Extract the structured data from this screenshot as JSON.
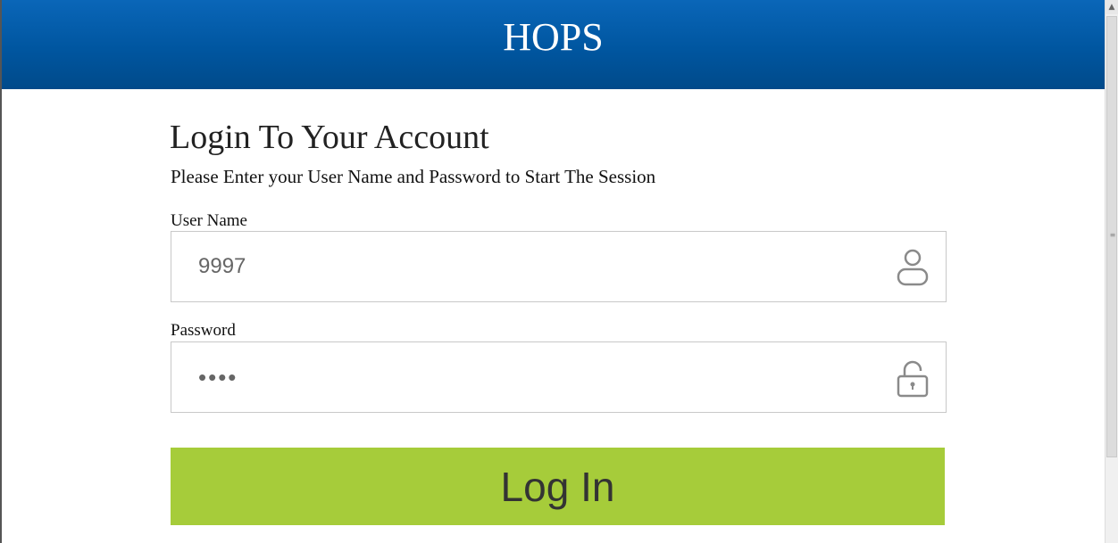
{
  "header": {
    "app_title": "HOPS",
    "bg_color": "#0056a0"
  },
  "login": {
    "title": "Login To Your Account",
    "subtitle": "Please Enter your User Name and Password to Start The Session",
    "username": {
      "label": "User Name",
      "value": "9997",
      "icon": "user-icon"
    },
    "password": {
      "label": "Password",
      "masked_value": "••••",
      "icon": "unlock-icon"
    },
    "button_label": "Log In",
    "button_color": "#a6cc3a"
  },
  "scrollbar": {
    "up_arrow": "▲",
    "grip": "≡"
  }
}
